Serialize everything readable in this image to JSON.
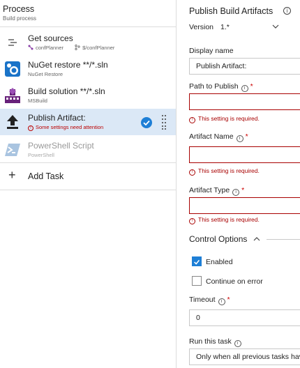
{
  "process": {
    "title": "Process",
    "subtitle": "Build process"
  },
  "tasks": [
    {
      "name": "Get sources",
      "sub_parts": [
        "confPlanner",
        "$/confPlanner"
      ]
    },
    {
      "name": "NuGet restore **/*.sln",
      "sub": "NuGet Restore"
    },
    {
      "name": "Build solution **/*.sln",
      "sub": "MSBuild"
    },
    {
      "name": "Publish Artifact:",
      "sub": "Some settings need attention"
    },
    {
      "name": "PowerShell Script",
      "sub": "PowerShell"
    }
  ],
  "add_task": {
    "label": "Add Task"
  },
  "panel": {
    "title": "Publish Build Artifacts",
    "version_label": "Version",
    "version_value": "1.*",
    "display_name": {
      "label": "Display name",
      "value": "Publish Artifact:"
    },
    "path_to_publish": {
      "label": "Path to Publish",
      "value": "",
      "error": "This setting is required."
    },
    "artifact_name": {
      "label": "Artifact Name",
      "value": "",
      "error": "This setting is required."
    },
    "artifact_type": {
      "label": "Artifact Type",
      "value": "",
      "error": "This setting is required."
    },
    "control_options": {
      "header": "Control Options",
      "enabled_label": "Enabled",
      "enabled": true,
      "continue_label": "Continue on error",
      "continue_on_error": false,
      "timeout_label": "Timeout",
      "timeout_value": "0",
      "run_label": "Run this task",
      "run_value": "Only when all previous tasks have succeeded"
    }
  },
  "colors": {
    "accent": "#1e7fd6",
    "error": "#a80000",
    "selected_bg": "#dbe8f6"
  }
}
